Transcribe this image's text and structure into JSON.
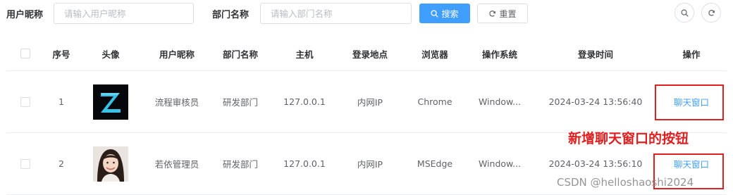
{
  "search": {
    "nickname_label": "用户昵称",
    "nickname_placeholder": "请输入用户昵称",
    "dept_label": "部门名称",
    "dept_placeholder": "请输入部门名称",
    "search_label": "搜索",
    "reset_label": "重置"
  },
  "table": {
    "headers": {
      "index": "序号",
      "avatar": "头像",
      "nickname": "用户昵称",
      "dept": "部门名称",
      "host": "主机",
      "location": "登录地点",
      "browser": "浏览器",
      "os": "操作系统",
      "login_time": "登录时间",
      "action": "操作"
    },
    "rows": [
      {
        "index": "1",
        "avatar": "z-logo-avatar",
        "nickname": "流程审核员",
        "dept": "研发部门",
        "host": "127.0.0.1",
        "location": "内网IP",
        "browser": "Chrome",
        "os": "Window...",
        "login_time": "2024-03-24 13:56:40",
        "action": "聊天窗口"
      },
      {
        "index": "2",
        "avatar": "woman-photo-avatar",
        "nickname": "若依管理员",
        "dept": "研发部门",
        "host": "127.0.0.1",
        "location": "内网IP",
        "browser": "MSEdge",
        "os": "Window...",
        "login_time": "2024-03-24 13:56:10",
        "action": "聊天窗口"
      }
    ]
  },
  "annotation": "新增聊天窗口的按钮",
  "watermark": "CSDN @helloshaoshi2024",
  "colors": {
    "primary": "#409eff",
    "annotation_red": "#e02020",
    "border": "#dcdfe6",
    "row_border": "#ebeef5"
  }
}
